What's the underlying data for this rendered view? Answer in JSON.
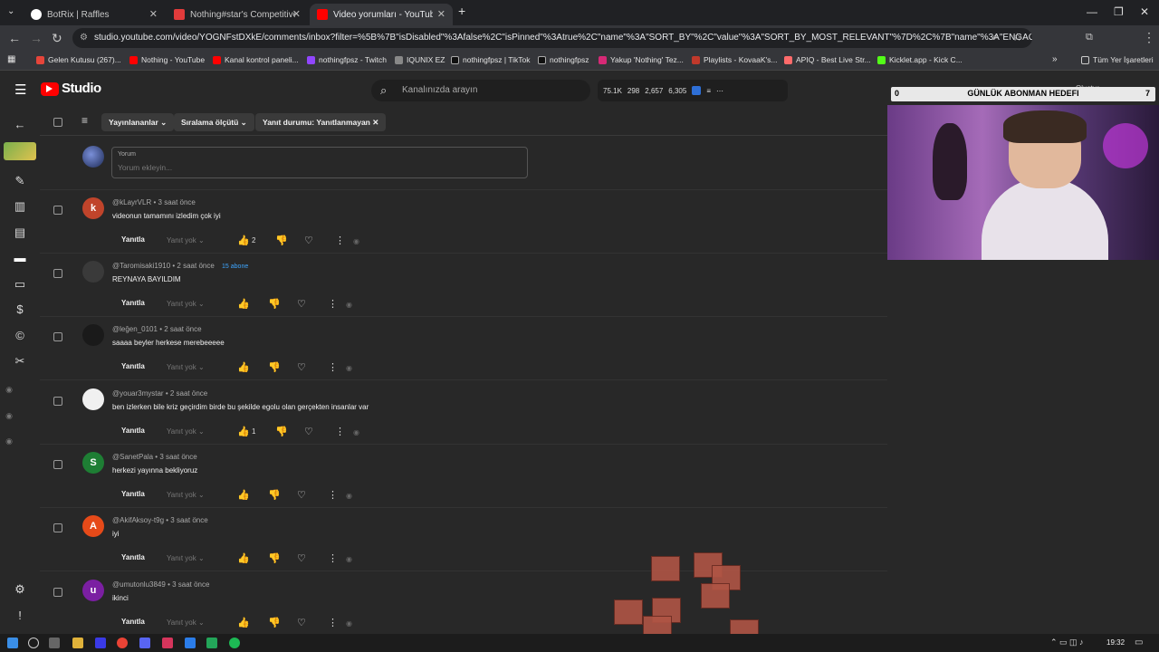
{
  "browser": {
    "tabs": [
      {
        "label": "BotRix | Raffles",
        "color": "#7a7a7a"
      },
      {
        "label": "Nothing#star's Competitive M...",
        "color": "#e23b3b"
      },
      {
        "label": "Video yorumları - YouTube Stu...",
        "color": "#ff0000"
      }
    ],
    "url": "studio.youtube.com/video/YOGNFstDXkE/comments/inbox?filter=%5B%7B\"isDisabled\"%3Afalse%2C\"isPinned\"%3Atrue%2C\"name\"%3A\"SORT_BY\"%2C\"value\"%3A\"SORT_BY_MOST_RELEVANT\"%7D%2C%7B\"name\"%3A\"ENGAGED_STATUS\"...",
    "bookmarks": [
      {
        "label": "Gelen Kutusu (267)...",
        "color": "#e6453a"
      },
      {
        "label": "Nothing - YouTube",
        "color": "#ff0000"
      },
      {
        "label": "Kanal kontrol paneli...",
        "color": "#ff0000"
      },
      {
        "label": "nothingfpsz - Twitch",
        "color": "#9146ff"
      },
      {
        "label": "IQUNIX EZ",
        "color": "#888888"
      },
      {
        "label": "nothingfpsz | TikTok",
        "color": "#111111"
      },
      {
        "label": "nothingfpsz",
        "color": "#111111"
      },
      {
        "label": "Yakup 'Nothing' Tez...",
        "color": "#d62976"
      },
      {
        "label": "Playlists - KovaaK's...",
        "color": "#c0392b"
      },
      {
        "label": "APIQ - Best Live Str...",
        "color": "#ff6b6b"
      },
      {
        "label": "Kicklet.app - Kick C...",
        "color": "#53fc18"
      },
      {
        "label": "Tüm Yer İşaretleri",
        "color": "#cccccc"
      }
    ]
  },
  "studio": {
    "logo": "Studio",
    "search_placeholder": "Kanalınızda arayın",
    "stats": [
      "75.1K",
      "298",
      "2,657",
      "6,305"
    ],
    "create_label": "Oluştur"
  },
  "goal": {
    "left": "0",
    "title": "GÜNLÜK ABONMAN HEDEFI",
    "right": "7"
  },
  "filters": {
    "chips": [
      "Yayınlananlar",
      "Sıralama ölçütü",
      "Yanıt durumu: Yanıtlanmayan"
    ]
  },
  "add_comment": {
    "label": "Yorum",
    "placeholder": "Yorum ekleyin..."
  },
  "comments": [
    {
      "author": "@kLayrVLR",
      "time": "3 saat önce",
      "text": "videonun tamamını izledim çok iyi",
      "likes": "2",
      "avatar_letter": "k",
      "avatar_color": "#c0442b",
      "badge": ""
    },
    {
      "author": "@Taromisaki1910",
      "time": "2 saat önce",
      "text": "REYNAYA BAYILDIM",
      "likes": "",
      "avatar_letter": "",
      "avatar_color": "#3a3a3a",
      "badge": "15 abone"
    },
    {
      "author": "@leğen_0101",
      "time": "2 saat önce",
      "text": "saaaa beyler herkese merebeeeee",
      "likes": "",
      "avatar_letter": "",
      "avatar_color": "#1a1a1a",
      "badge": ""
    },
    {
      "author": "@youar3mystar",
      "time": "2 saat önce",
      "text": "ben izlerken bile kriz geçirdim birde bu şekilde egolu olan gerçekten insanlar var",
      "likes": "1",
      "avatar_letter": "",
      "avatar_color": "#f0f0f0",
      "badge": ""
    },
    {
      "author": "@SanetPala",
      "time": "3 saat önce",
      "text": "herkezi yayınna bekliyoruz",
      "likes": "",
      "avatar_letter": "S",
      "avatar_color": "#1e7e34",
      "badge": ""
    },
    {
      "author": "@AkifAksoy-t9g",
      "time": "3 saat önce",
      "text": "iyi",
      "likes": "",
      "avatar_letter": "A",
      "avatar_color": "#e64a19",
      "badge": ""
    },
    {
      "author": "@umutonlu3849",
      "time": "3 saat önce",
      "text": "ikinci",
      "likes": "",
      "avatar_letter": "u",
      "avatar_color": "#7b1fa2",
      "badge": ""
    }
  ],
  "reply_label": "Yanıtla",
  "no_reply_label": "Yanıt yok",
  "taskbar": {
    "time": "19:32"
  }
}
